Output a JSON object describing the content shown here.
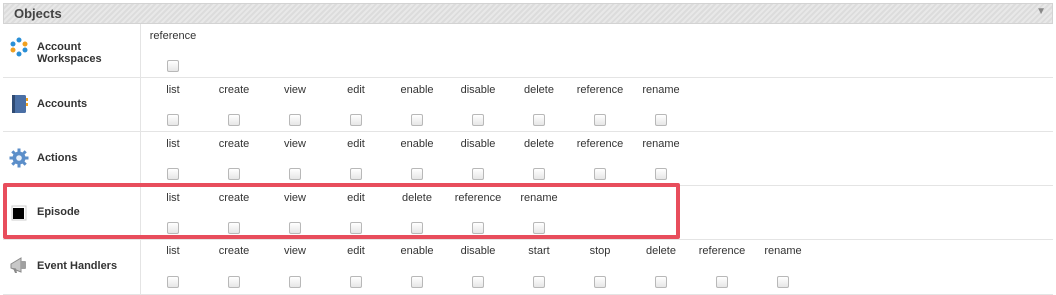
{
  "panel": {
    "title": "Objects"
  },
  "rows": [
    {
      "name_line1": "Account",
      "name_line2": "Workspaces",
      "icon": "dots-circle-icon",
      "perms": [
        "reference"
      ]
    },
    {
      "name": "Accounts",
      "icon": "address-book-icon",
      "perms": [
        "list",
        "create",
        "view",
        "edit",
        "enable",
        "disable",
        "delete",
        "reference",
        "rename"
      ]
    },
    {
      "name": "Actions",
      "icon": "gear-icon",
      "perms": [
        "list",
        "create",
        "view",
        "edit",
        "enable",
        "disable",
        "delete",
        "reference",
        "rename"
      ]
    },
    {
      "name": "Episode",
      "icon": "black-square-icon",
      "perms": [
        "list",
        "create",
        "view",
        "edit",
        "delete",
        "reference",
        "rename"
      ]
    },
    {
      "name": "Event Handlers",
      "icon": "megaphone-icon",
      "perms": [
        "list",
        "create",
        "view",
        "edit",
        "enable",
        "disable",
        "start",
        "stop",
        "delete",
        "reference",
        "rename"
      ]
    }
  ],
  "colors": {
    "highlight": "#e84d5c"
  }
}
